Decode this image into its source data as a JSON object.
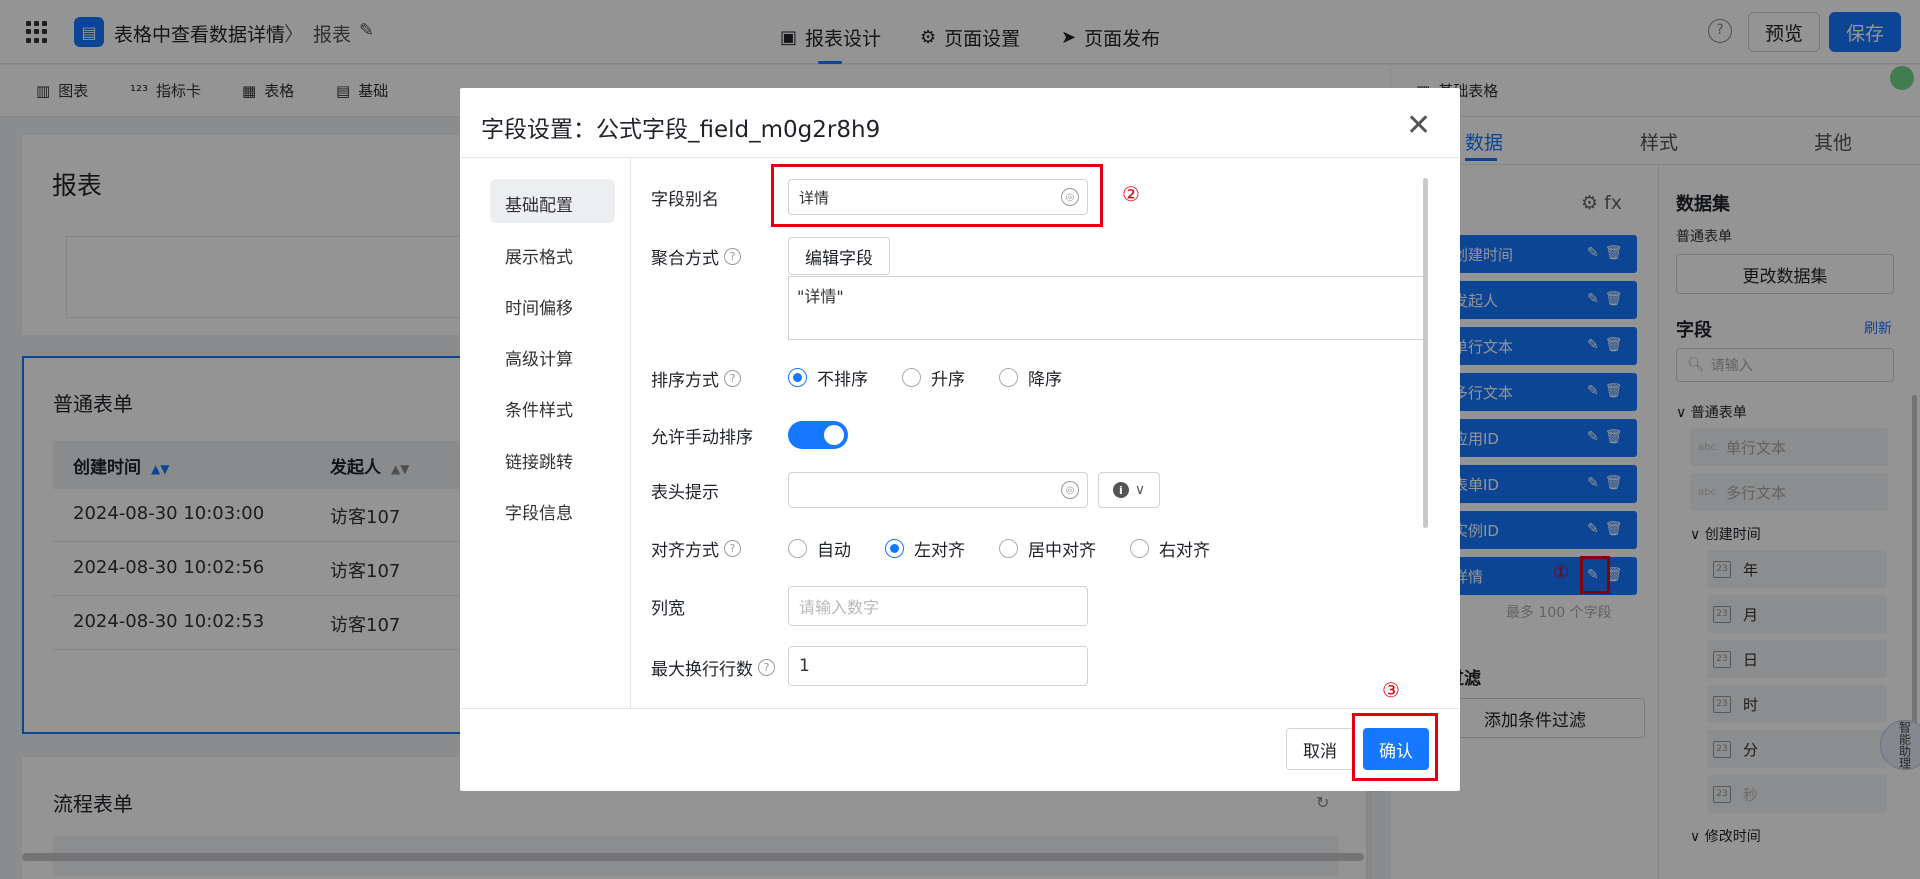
{
  "header": {
    "app_name": "表格中查看数据详情",
    "crumb_sep": "〉",
    "crumb_report": "报表",
    "tabs": [
      {
        "icon": "▣",
        "label": "报表设计"
      },
      {
        "icon": "⚙",
        "label": "页面设置"
      },
      {
        "icon": "➤",
        "label": "页面发布"
      }
    ],
    "help": "?",
    "preview_label": "预览",
    "save_label": "保存"
  },
  "toolbar": {
    "items": [
      {
        "icon": "▥",
        "label": "图表"
      },
      {
        "icon": "¹²³",
        "label": "指标卡"
      },
      {
        "icon": "▦",
        "label": "表格"
      },
      {
        "icon": "▤",
        "label": "基础"
      }
    ],
    "right_table_label": "基础表格"
  },
  "canvas": {
    "report_title": "报表",
    "form_card": {
      "title": "普通表单",
      "columns": [
        "创建时间",
        "发起人"
      ],
      "rows": [
        [
          "2024-08-30 10:03:00",
          "访客107"
        ],
        [
          "2024-08-30 10:02:56",
          "访客107"
        ],
        [
          "2024-08-30 10:02:53",
          "访客107"
        ]
      ]
    },
    "flow_card": {
      "title": "流程表单"
    }
  },
  "right_panel": {
    "tabs": [
      "数据",
      "样式",
      "其他"
    ],
    "fx": "⚙  fx",
    "fields": [
      "创建时间",
      "发起人",
      "单行文本",
      "多行文本",
      "应用ID",
      "表单ID",
      "实例ID",
      "详情"
    ],
    "field_limit": "最多 100 个字段",
    "filter_title": "过滤",
    "add_filter_label": "添加条件过滤",
    "dataset_title": "数据集",
    "dataset_name": "普通表单",
    "change_dataset_label": "更改数据集",
    "field_title": "字段",
    "refresh_label": "刷新",
    "search_placeholder": "请输入",
    "tree": {
      "group": "普通表单",
      "text_fields": [
        {
          "tag": "abc",
          "label": "单行文本"
        },
        {
          "tag": "abc",
          "label": "多行文本"
        }
      ],
      "date_group": "创建时间",
      "date_parts": [
        "年",
        "月",
        "日",
        "时",
        "分",
        "秒"
      ],
      "next_group": "修改时间"
    },
    "float_label": "智能助理"
  },
  "modal": {
    "title": "字段设置：公式字段_field_m0g2r8h9",
    "close": "✕",
    "side_items": [
      "基础配置",
      "展示格式",
      "时间偏移",
      "高级计算",
      "条件样式",
      "链接跳转",
      "字段信息"
    ],
    "alias_label": "字段别名",
    "alias_value": "详情",
    "agg_label": "聚合方式",
    "edit_field_label": "编辑字段",
    "formula": "\"详情\"",
    "sort_label": "排序方式",
    "sort_options": [
      "不排序",
      "升序",
      "降序"
    ],
    "sort_selected": 0,
    "manual_sort_label": "允许手动排序",
    "manual_sort_on": true,
    "header_tip_label": "表头提示",
    "header_tip_value": "",
    "align_label": "对齐方式",
    "align_options": [
      "自动",
      "左对齐",
      "居中对齐",
      "右对齐"
    ],
    "align_selected": 1,
    "width_label": "列宽",
    "width_placeholder": "请输入数字",
    "max_lines_label": "最大换行行数",
    "max_lines_value": "1",
    "cancel_label": "取消",
    "confirm_label": "确认"
  },
  "annotations": [
    "①",
    "②",
    "③"
  ],
  "colors": {
    "accent": "#1677ff",
    "annotation": "#e3000f"
  }
}
